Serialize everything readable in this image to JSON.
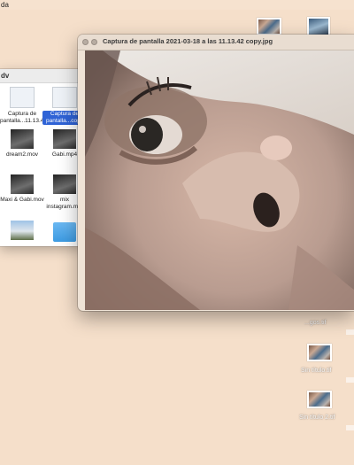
{
  "menubar": {
    "app_fragment": "da"
  },
  "finder": {
    "title": "dv",
    "items": [
      {
        "label": "Captura de pantalla...11.13.42",
        "thumb": "screenshot",
        "selected": false
      },
      {
        "label": "Captura de pantalla...copy",
        "thumb": "screenshot",
        "selected": true
      },
      {
        "label": "dream2.mov",
        "thumb": "video",
        "selected": false
      },
      {
        "label": "Gabi.mp4",
        "thumb": "video",
        "selected": false
      },
      {
        "label": "Maxi & Gabi.mov",
        "thumb": "video",
        "selected": false
      },
      {
        "label": "mix instagram.m...",
        "thumb": "video",
        "selected": false
      },
      {
        "label": "",
        "thumb": "video",
        "selected": false
      },
      {
        "label": "",
        "thumb": "folder",
        "selected": false
      }
    ]
  },
  "preview": {
    "title": "Captura de pantalla 2021-03-18 a las 11.13.42 copy.jpg",
    "image_icon": "face-closeup-photo"
  },
  "desktop_icons": [
    {
      "label": "",
      "icon": "photo-collage-icon"
    },
    {
      "label": "",
      "icon": "photo-icon"
    },
    {
      "label": "...gos.tif",
      "icon": "photo-icon"
    },
    {
      "label": "Sin título.tif",
      "icon": "photo-collage-icon"
    },
    {
      "label": "Sin título 2.tif",
      "icon": "photo-collage-icon"
    }
  ]
}
